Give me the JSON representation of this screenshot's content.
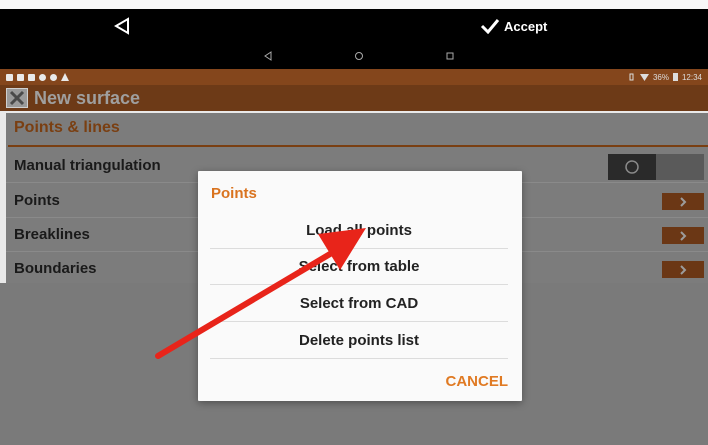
{
  "action_bar": {
    "accept_label": "Accept"
  },
  "app_bar": {
    "title": "New surface"
  },
  "status_bar": {
    "battery": "36%",
    "time": "12:34"
  },
  "content": {
    "section_title": "Points & lines",
    "rows": [
      {
        "label": "Manual triangulation"
      },
      {
        "label": "Points"
      },
      {
        "label": "Breaklines"
      },
      {
        "label": "Boundaries"
      }
    ]
  },
  "dialog": {
    "title": "Points",
    "items": [
      "Load all points",
      "Select from table",
      "Select from CAD",
      "Delete points list"
    ],
    "cancel_label": "CANCEL"
  },
  "colors": {
    "accent": "#e07a23",
    "app_bar": "#6d3a17",
    "annotation_arrow": "#e8241a"
  }
}
